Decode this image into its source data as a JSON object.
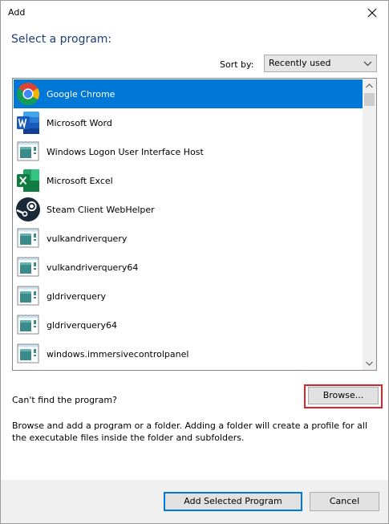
{
  "window": {
    "title": "Add",
    "close_icon": "close-icon"
  },
  "heading": "Select a program:",
  "sort": {
    "label": "Sort by:",
    "selected": "Recently used"
  },
  "programs": [
    {
      "name": "Google Chrome",
      "icon": "chrome-icon",
      "selected": true
    },
    {
      "name": "Microsoft Word",
      "icon": "word-icon",
      "selected": false
    },
    {
      "name": "Windows Logon User Interface Host",
      "icon": "app-window-icon",
      "selected": false
    },
    {
      "name": "Microsoft Excel",
      "icon": "excel-icon",
      "selected": false
    },
    {
      "name": "Steam Client WebHelper",
      "icon": "steam-icon",
      "selected": false
    },
    {
      "name": "vulkandriverquery",
      "icon": "app-window-icon",
      "selected": false
    },
    {
      "name": "vulkandriverquery64",
      "icon": "app-window-icon",
      "selected": false
    },
    {
      "name": "gldriverquery",
      "icon": "app-window-icon",
      "selected": false
    },
    {
      "name": "gldriverquery64",
      "icon": "app-window-icon",
      "selected": false
    },
    {
      "name": "windows.immersivecontrolpanel",
      "icon": "app-window-icon",
      "selected": false
    }
  ],
  "cant_find": "Can't find the program?",
  "browse_label": "Browse...",
  "description": "Browse and add a program or a folder. Adding a folder will create a profile for all the executable files inside the folder and subfolders.",
  "footer": {
    "add_label": "Add Selected Program",
    "cancel_label": "Cancel"
  },
  "colors": {
    "selection": "#0078d7",
    "heading": "#1e3f7a",
    "highlight": "#d9232d"
  }
}
